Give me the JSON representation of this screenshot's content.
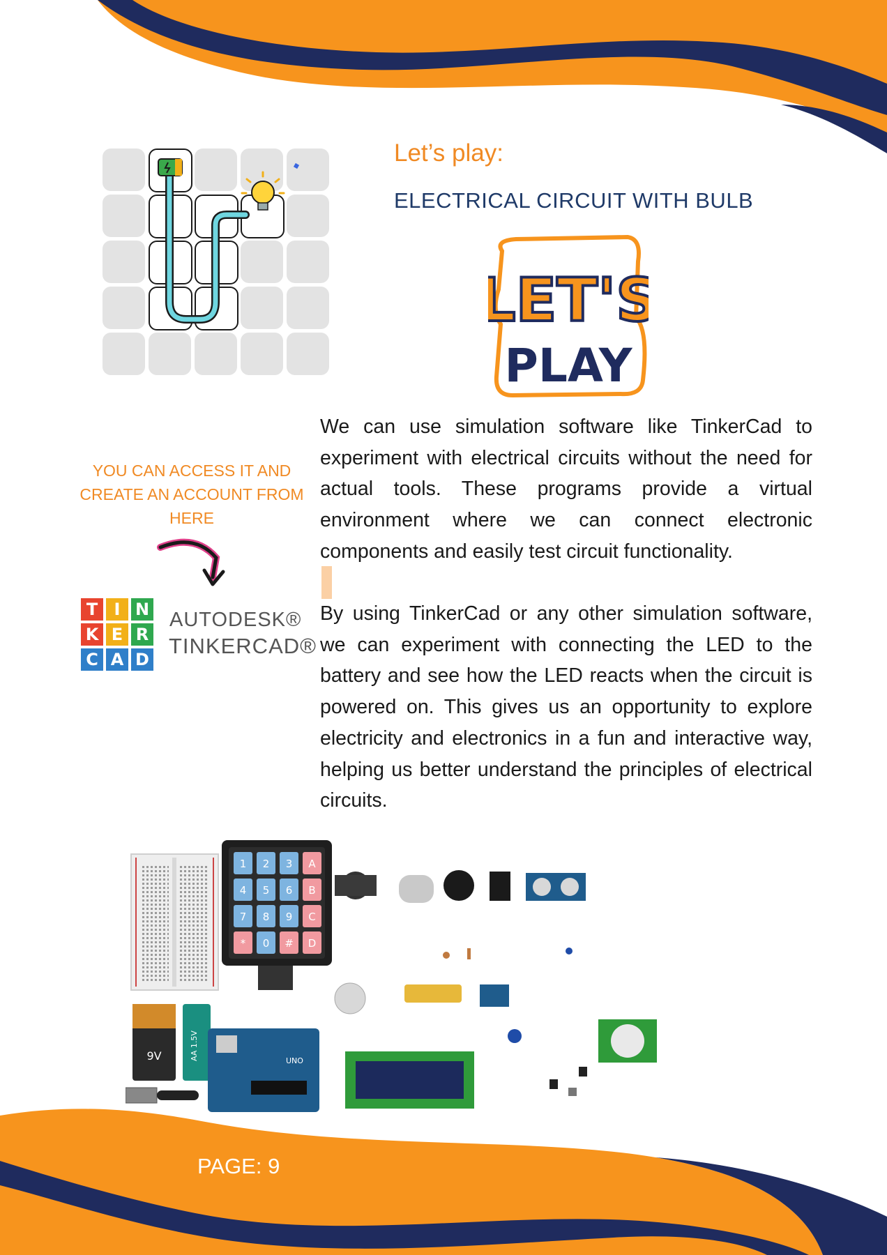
{
  "heading": {
    "lets_play": "Let’s play:",
    "subtitle": "ELECTRICAL CIRCUIT WITH BULB"
  },
  "logo": {
    "line1": "LET'S",
    "line2": "PLAY"
  },
  "access_note": "YOU CAN ACCESS IT AND CREATE AN ACCOUNT FROM HERE",
  "tinkercad": {
    "tiles": [
      "T",
      "I",
      "N",
      "K",
      "E",
      "R",
      "C",
      "A",
      "D"
    ],
    "tile_colors": [
      "#e8442f",
      "#f2b019",
      "#2fa84f",
      "#e8442f",
      "#f2b019",
      "#2fa84f",
      "#2f7fc9",
      "#2f7fc9",
      "#2f7fc9"
    ],
    "autodesk": "AUTODESK®",
    "name": "TINKERCAD®"
  },
  "paragraphs": [
    "We can use simulation software like TinkerCad to experiment with electrical circuits without the need for actual tools. These programs provide a virtual environment where we can connect electronic components and easily test circuit functionality.",
    "By using TinkerCad or any other simulation software, we can experiment with connecting the LED to the battery and see how the LED reacts when the circuit is powered on. This gives us an opportunity to explore electricity and electronics in a fun and interactive way, helping us better understand the principles of electrical circuits."
  ],
  "components": {
    "keypad_keys": [
      "1",
      "2",
      "3",
      "A",
      "4",
      "5",
      "6",
      "B",
      "7",
      "8",
      "9",
      "C",
      "*",
      "0",
      "#",
      "D"
    ],
    "battery_9v": "9V",
    "battery_aa": "AA 1.5V",
    "board": "UNO"
  },
  "footer": {
    "page": "PAGE: 9"
  },
  "colors": {
    "orange": "#f7941d",
    "navy": "#1f2b5e",
    "accent_text": "#f08a24"
  }
}
